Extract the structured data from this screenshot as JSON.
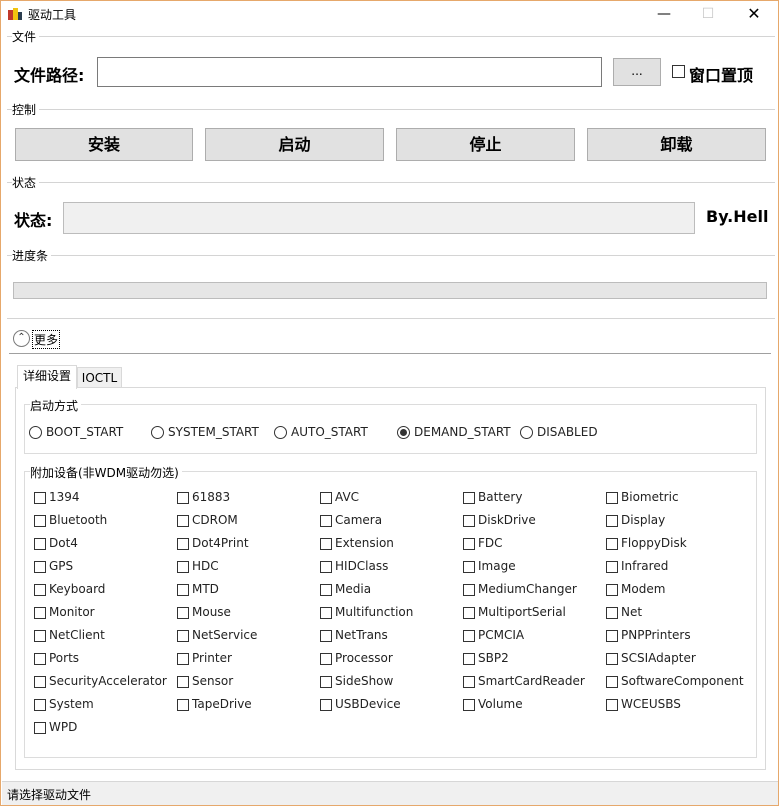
{
  "window": {
    "title": "驱动工具",
    "minimize": "—",
    "maximize": "☐",
    "close": "✕"
  },
  "file_group": {
    "label": "文件",
    "path_label": "文件路径:",
    "path_value": "",
    "browse_label": "...",
    "topmost_label": "窗口置顶",
    "topmost_checked": false
  },
  "control_group": {
    "label": "控制",
    "buttons": [
      "安装",
      "启动",
      "停止",
      "卸载"
    ]
  },
  "status_group": {
    "label": "状态",
    "status_label": "状态:",
    "status_value": "",
    "author": "By.Hell"
  },
  "progress_group": {
    "label": "进度条",
    "progress_fraction": 0
  },
  "more": {
    "label": "更多",
    "expanded": true
  },
  "tabs": [
    {
      "label": "详细设置",
      "active": true
    },
    {
      "label": "IOCTL",
      "active": false
    }
  ],
  "start_mode": {
    "label": "启动方式",
    "options": [
      "BOOT_START",
      "SYSTEM_START",
      "AUTO_START",
      "DEMAND_START",
      "DISABLED"
    ],
    "selected": "DEMAND_START"
  },
  "devices": {
    "label": "附加设备(非WDM驱动勿选)",
    "items": [
      "1394",
      "61883",
      "AVC",
      "Battery",
      "Biometric",
      "Bluetooth",
      "CDROM",
      "Camera",
      "DiskDrive",
      "Display",
      "Dot4",
      "Dot4Print",
      "Extension",
      "FDC",
      "FloppyDisk",
      "GPS",
      "HDC",
      "HIDClass",
      "Image",
      "Infrared",
      "Keyboard",
      "MTD",
      "Media",
      "MediumChanger",
      "Modem",
      "Monitor",
      "Mouse",
      "Multifunction",
      "MultiportSerial",
      "Net",
      "NetClient",
      "NetService",
      "NetTrans",
      "PCMCIA",
      "PNPPrinters",
      "Ports",
      "Printer",
      "Processor",
      "SBP2",
      "SCSIAdapter",
      "SecurityAccelerator",
      "Sensor",
      "SideShow",
      "SmartCardReader",
      "SoftwareComponent",
      "System",
      "TapeDrive",
      "USBDevice",
      "Volume",
      "WCEUSBS",
      "WPD"
    ]
  },
  "statusbar": {
    "text": "请选择驱动文件"
  }
}
